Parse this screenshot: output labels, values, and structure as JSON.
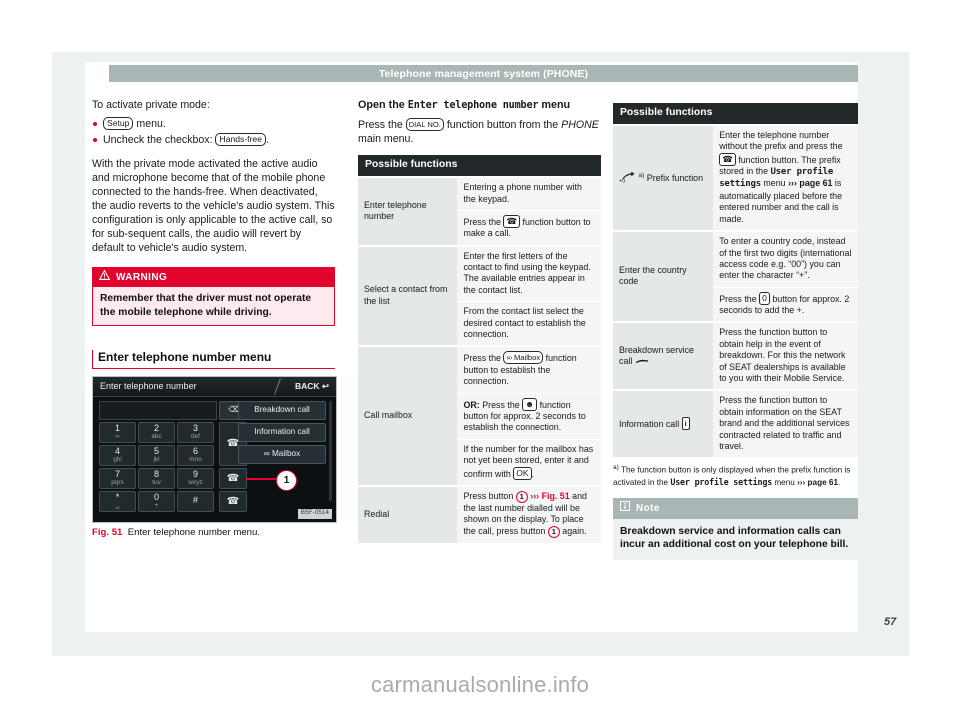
{
  "header": {
    "title": "Telephone management system (PHONE)"
  },
  "page_number": "57",
  "watermark": "carmanualsonline.info",
  "column_left": {
    "intro": "To activate private mode:",
    "bullets": [
      {
        "prefix": "",
        "key": "Setup",
        "suffix": " menu."
      },
      {
        "prefix": "Uncheck the checkbox: ",
        "key": "Hands-free",
        "suffix": "."
      }
    ],
    "paragraph": "With the private mode activated the active audio and microphone become that of the mobile phone connected to the hands-free. When deactivated, the audio reverts to the vehicle's audio system. This configuration is only applicable to the active call, so for sub-sequent calls, the audio will revert by default to vehicle's audio system.",
    "warning": {
      "title": "WARNING",
      "icon": "warning-triangle-icon",
      "text": "Remember that the driver must not operate the mobile telephone while driving."
    },
    "section_heading": "Enter telephone number menu",
    "figure": {
      "screen_title": "Enter telephone number",
      "back_label": "BACK",
      "delete_icon": "backspace-icon",
      "keys": [
        {
          "num": "1",
          "sub": "∞"
        },
        {
          "num": "2",
          "sub": "abc"
        },
        {
          "num": "3",
          "sub": "def"
        },
        {
          "num": "4",
          "sub": "ghi"
        },
        {
          "num": "5",
          "sub": "jkl"
        },
        {
          "num": "6",
          "sub": "mno"
        },
        {
          "num": "7",
          "sub": "pqrs"
        },
        {
          "num": "8",
          "sub": "tuv"
        },
        {
          "num": "9",
          "sub": "wxyz"
        },
        {
          "num": "*",
          "sub": "␣"
        },
        {
          "num": "0",
          "sub": "+"
        },
        {
          "num": "#",
          "sub": ""
        }
      ],
      "side_keys": [
        "headset-icon",
        "call-green-icon",
        "prefix-call-icon"
      ],
      "menu_items": [
        "Breakdown call",
        "Information call",
        "Mailbox"
      ],
      "mailbox_icon": "mailbox-icon",
      "callout_number": "1",
      "image_code": "B5F-0514",
      "caption_label": "Fig. 51",
      "caption_text": "Enter telephone number menu."
    }
  },
  "column_middle": {
    "subhead_pre": "Open the ",
    "subhead_mono": "Enter telephone number",
    "subhead_post": " menu",
    "instruction_pre": "Press the ",
    "instruction_key": "DIAL NO.",
    "instruction_post": " function button from the ",
    "instruction_italic": "PHONE",
    "instruction_end": " main menu.",
    "table": {
      "caption": "Possible functions",
      "rows": [
        {
          "label": "Enter telephone number",
          "cells": [
            {
              "text": "Entering a phone number with the keypad."
            },
            {
              "pre": "Press the ",
              "key_icon": "call-icon",
              "post": " function button to make a call."
            }
          ]
        },
        {
          "label": "Select a contact from the list",
          "cells": [
            {
              "text": "Enter the first letters of the contact to find using the keypad. The available entries appear in the contact list."
            },
            {
              "text": "From the contact list select the desired contact to establish the connection."
            }
          ]
        },
        {
          "label": "Call mailbox",
          "cells": [
            {
              "pre": "Press the ",
              "key": "∞ Mailbox",
              "post": " function button to establish the connection."
            },
            {
              "bold": "OR:",
              "pre": " Press the ",
              "key_icon": "mailbox-button-icon",
              "post": " function button for approx. 2 seconds to establish the connection."
            },
            {
              "pre": "If the number for the mailbox has not yet been stored, enter it and confirm with ",
              "key": "OK",
              "post": "."
            }
          ]
        },
        {
          "label": "Redial",
          "cells": [
            {
              "pre": "Press button ",
              "circle": "1",
              "ref": "››› Fig. 51",
              "post": " and the last number dialled will be shown on the display. To place the call, press button ",
              "circle2": "1",
              "post2": " again."
            }
          ]
        }
      ]
    }
  },
  "column_right": {
    "table": {
      "caption": "Possible functions",
      "rows": [
        {
          "label_icon": "prefix-call-icon",
          "label_sup": "a)",
          "label": " Prefix function",
          "cells": [
            {
              "pre": "Enter the telephone number without the prefix and press the ",
              "key_icon": "call-icon",
              "mid": " function button. The prefix stored in the ",
              "mono": "User profile settings",
              "mid2": " menu ",
              "ref": "››› page 61",
              "post": " is automatically placed before the entered number and the call is made."
            }
          ]
        },
        {
          "label": "Enter the country code",
          "cells": [
            {
              "text": "To enter a country code, instead of the first two digits (international access code e.g. “00”) you can enter the character “+”."
            },
            {
              "pre": "Press the ",
              "key": "0",
              "post": " button for approx. 2 seconds to add the +."
            }
          ]
        },
        {
          "label": "Breakdown service call",
          "label_icon": "breakdown-wrench-icon",
          "cells": [
            {
              "text": "Press the function button to obtain help in the event of breakdown. For this the network of SEAT dealerships is available to you with their Mobile Service."
            }
          ]
        },
        {
          "label": "Information call",
          "label_icon": "info-circle-icon",
          "cells": [
            {
              "text": "Press the function button to obtain information on the SEAT brand and the additional services contracted related to traffic and travel."
            }
          ]
        }
      ]
    },
    "footnote": {
      "marker": "a)",
      "pre": " The function button is only displayed when the prefix function is activated in the ",
      "mono": "User profile settings",
      "mid": " menu ",
      "ref": "››› page 61",
      "post": "."
    },
    "note": {
      "title": "Note",
      "icon": "info-note-icon",
      "text": "Breakdown service and information calls can incur an additional cost on your telephone bill."
    }
  },
  "colors": {
    "accent_red": "#e1052e",
    "header_grey": "#a8b6b6",
    "table_header": "#23282a",
    "paper_grey": "#eef1f2"
  }
}
